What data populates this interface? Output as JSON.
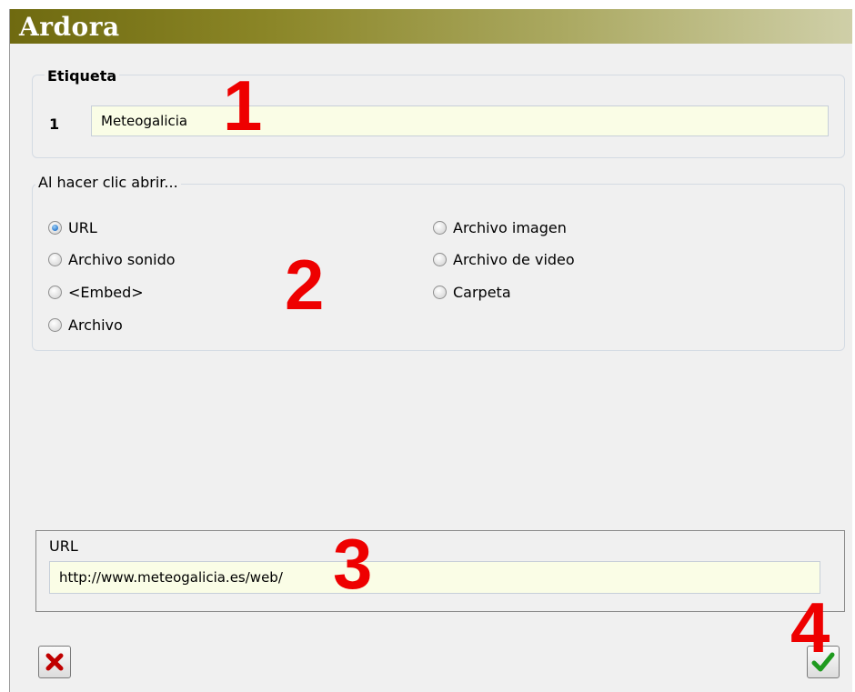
{
  "window": {
    "title": "Ardora"
  },
  "etiqueta": {
    "legend": "Etiqueta",
    "index": "1",
    "value": "Meteogalicia"
  },
  "open_group": {
    "legend": "Al hacer clic abrir...",
    "selected": "URL",
    "options_left": [
      "URL",
      "Archivo sonido",
      "<Embed>",
      "Archivo"
    ],
    "options_right": [
      "Archivo imagen",
      "Archivo de video",
      "Carpeta"
    ]
  },
  "url_panel": {
    "label": "URL",
    "value": "http://www.meteogalicia.es/web/"
  },
  "annotations": [
    "1",
    "2",
    "3",
    "4"
  ],
  "buttons": {
    "cancel_icon": "red-x-icon",
    "ok_icon": "green-check-icon"
  },
  "colors": {
    "annotation": "#ee0000",
    "field_bg": "#fafde6",
    "check": "#1f9a1f",
    "cross": "#c00000"
  }
}
